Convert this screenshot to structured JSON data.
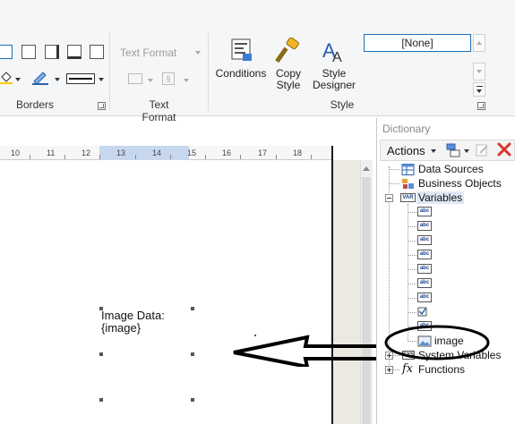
{
  "ribbon": {
    "groups": {
      "borders": "Borders",
      "text_format": "Text Format",
      "style": "Style"
    },
    "text_format_dropdown": "Text Format",
    "buttons": {
      "conditions": "Conditions",
      "copy_style": "Copy\nStyle",
      "style_designer": "Style\nDesigner"
    },
    "style_value": "[None]"
  },
  "ruler": {
    "ticks": [
      "10",
      "11",
      "12",
      "13",
      "14",
      "15",
      "16",
      "17",
      "18"
    ]
  },
  "canvas": {
    "image_text": "Image Data:\n{image}"
  },
  "dictionary": {
    "title": "Dictionary",
    "actions_label": "Actions",
    "tree": {
      "data_sources": "Data Sources",
      "business_objects": "Business Objects",
      "variables": "Variables",
      "variable_items": [
        "",
        "",
        "",
        "",
        "",
        "",
        "",
        "",
        "",
        "image"
      ],
      "system_variables": "System Variables",
      "functions": "Functions"
    }
  },
  "colors": {
    "accent": "#1e6fb8",
    "ruler_highlight": "#c7d8ee",
    "annotation": "#000000",
    "delete_red": "#d9342b"
  },
  "icons": [
    "border-icon",
    "fill-color-icon",
    "line-color-icon",
    "line-style-icon",
    "conditions-icon",
    "copy-style-icon",
    "style-designer-icon",
    "data-sources-icon",
    "business-objects-icon",
    "variables-icon",
    "variable-icon",
    "image-variable-icon",
    "system-variables-icon",
    "functions-icon",
    "delete-icon",
    "edit-icon",
    "new-item-icon"
  ]
}
